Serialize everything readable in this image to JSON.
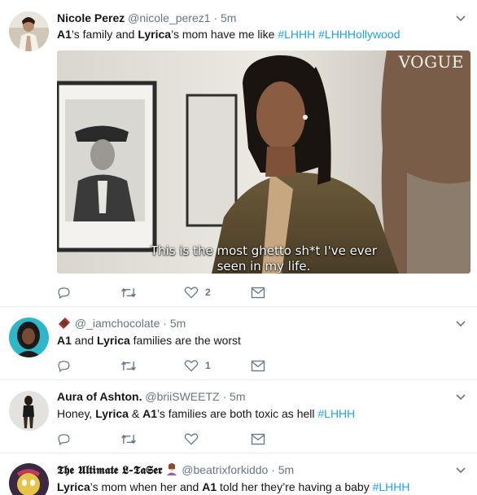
{
  "colors": {
    "link": "#1da1f2",
    "muted": "#657786",
    "text": "#14171a",
    "divider": "#e6ecf0"
  },
  "tweets": [
    {
      "name": "Nicole Perez",
      "handle": "@nicole_perez1",
      "dot": "·",
      "time": "5m",
      "text_parts": [
        {
          "t": "A1",
          "bold": true
        },
        {
          "t": "’s family and "
        },
        {
          "t": "Lyrica",
          "bold": true
        },
        {
          "t": "’s mom have me like "
        },
        {
          "t": "#LHHH",
          "link": true
        },
        {
          "t": " "
        },
        {
          "t": "#LHHHollywood",
          "link": true
        }
      ],
      "media": {
        "watermark": "VOGUE",
        "caption_line1": "This is the most ghetto sh*t I've ever",
        "caption_line2": "seen in my life."
      },
      "actions": {
        "reply": "",
        "retweet": "",
        "like": "2",
        "message": ""
      }
    },
    {
      "name": "",
      "name_emoji": "chocolate-bar-icon",
      "handle": "@_iamchocolate",
      "dot": "·",
      "time": "5m",
      "text_parts": [
        {
          "t": "A1",
          "bold": true
        },
        {
          "t": " and "
        },
        {
          "t": "Lyrica",
          "bold": true
        },
        {
          "t": " families are the worst"
        }
      ],
      "actions": {
        "reply": "",
        "retweet": "",
        "like": "1",
        "message": ""
      }
    },
    {
      "name": "Aura of Ashton.",
      "handle": "@briiSWEETZ",
      "dot": "·",
      "time": "5m",
      "text_parts": [
        {
          "t": "Honey, "
        },
        {
          "t": "Lyrica",
          "bold": true
        },
        {
          "t": " & "
        },
        {
          "t": "A1",
          "bold": true
        },
        {
          "t": "’s families are both toxic as hell "
        },
        {
          "t": "#LHHH",
          "link": true
        }
      ],
      "actions": {
        "reply": "",
        "retweet": "",
        "like": "",
        "message": ""
      }
    },
    {
      "name": "𝕿𝖍𝖊 𝖀𝖑𝖙𝖎𝖒𝖆𝖙𝖊 𝕷-𝕿𝖆𝕾𝖊𝖗",
      "name_emoji": "woman-gesturing-icon",
      "handle": "@beatrixforkiddo",
      "dot": "·",
      "time": "5m",
      "text_parts": [
        {
          "t": "Lyrica",
          "bold": true
        },
        {
          "t": "’s mom when her and "
        },
        {
          "t": "A1",
          "bold": true
        },
        {
          "t": " told her they’re having a baby "
        },
        {
          "t": "#LHHH",
          "link": true
        }
      ]
    }
  ]
}
